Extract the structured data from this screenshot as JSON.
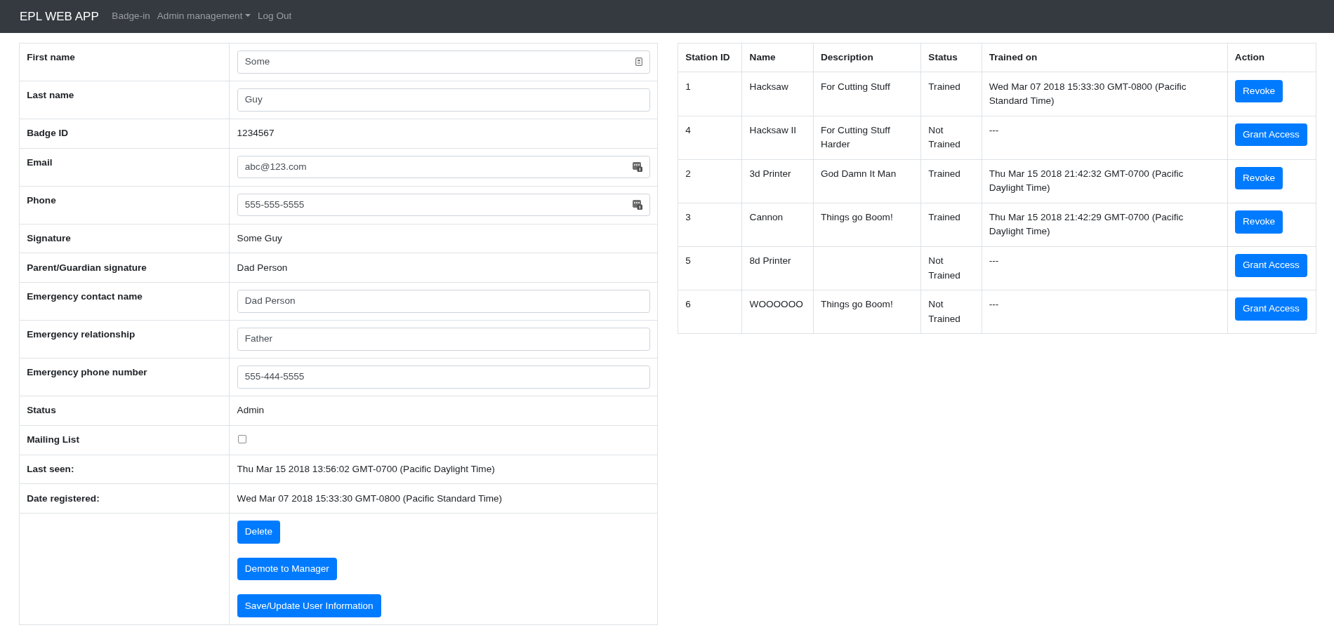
{
  "navbar": {
    "brand": "EPL WEB APP",
    "links": [
      {
        "label": "Badge-in",
        "kind": "link"
      },
      {
        "label": "Admin management",
        "kind": "dropdown"
      },
      {
        "label": "Log Out",
        "kind": "link"
      }
    ]
  },
  "user_details": {
    "rows": [
      {
        "label": "First name",
        "kind": "input_card_icon",
        "value": "Some"
      },
      {
        "label": "Last name",
        "kind": "input",
        "value": "Guy"
      },
      {
        "label": "Badge ID",
        "kind": "text",
        "value": "1234567"
      },
      {
        "label": "Email",
        "kind": "input_dots_icon",
        "value": "abc@123.com"
      },
      {
        "label": "Phone",
        "kind": "input_dots_icon",
        "value": "555-555-5555"
      },
      {
        "label": "Signature",
        "kind": "text",
        "value": "Some Guy"
      },
      {
        "label": "Parent/Guardian signature",
        "kind": "text",
        "value": "Dad Person"
      },
      {
        "label": "Emergency contact name",
        "kind": "input",
        "value": "Dad Person"
      },
      {
        "label": "Emergency relationship",
        "kind": "input",
        "value": "Father"
      },
      {
        "label": "Emergency phone number",
        "kind": "input",
        "value": "555-444-5555"
      },
      {
        "label": "Status",
        "kind": "text",
        "value": "Admin"
      },
      {
        "label": "Mailing List",
        "kind": "checkbox",
        "checked": false
      },
      {
        "label": "Last seen:",
        "kind": "text",
        "value": "Thu Mar 15 2018 13:56:02 GMT-0700 (Pacific Daylight Time)"
      },
      {
        "label": "Date registered:",
        "kind": "text",
        "value": "Wed Mar 07 2018 15:33:30 GMT-0800 (Pacific Standard Time)"
      }
    ],
    "actions": [
      "Delete",
      "Demote to Manager",
      "Save/Update User Information"
    ]
  },
  "stations": {
    "columns": [
      "Station ID",
      "Name",
      "Description",
      "Status",
      "Trained on",
      "Action"
    ],
    "rows": [
      {
        "station_id": "1",
        "name": "Hacksaw",
        "description": "For Cutting Stuff",
        "status": "Trained",
        "trained_on": "Wed Mar 07 2018 15:33:30 GMT-0800 (Pacific Standard Time)",
        "action": "Revoke"
      },
      {
        "station_id": "4",
        "name": "Hacksaw II",
        "description": "For Cutting Stuff Harder",
        "status": "Not Trained",
        "trained_on": "---",
        "action": "Grant Access"
      },
      {
        "station_id": "2",
        "name": "3d Printer",
        "description": "God Damn It Man",
        "status": "Trained",
        "trained_on": "Thu Mar 15 2018 21:42:32 GMT-0700 (Pacific Daylight Time)",
        "action": "Revoke"
      },
      {
        "station_id": "3",
        "name": "Cannon",
        "description": "Things go Boom!",
        "status": "Trained",
        "trained_on": "Thu Mar 15 2018 21:42:29 GMT-0700 (Pacific Daylight Time)",
        "action": "Revoke"
      },
      {
        "station_id": "5",
        "name": "8d Printer",
        "status": "Not Trained",
        "trained_on": "---",
        "action": "Grant Access"
      },
      {
        "station_id": "6",
        "name": "WOOOOOO",
        "description": "Things go Boom!",
        "status": "Not Trained",
        "trained_on": "---",
        "action": "Grant Access"
      }
    ]
  }
}
